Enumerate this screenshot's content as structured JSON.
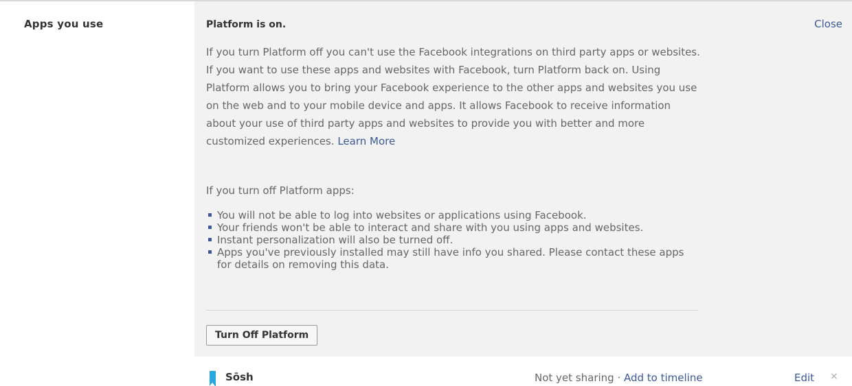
{
  "section": {
    "label": "Apps you use"
  },
  "panel": {
    "title": "Platform is on.",
    "close_label": "Close",
    "description": "If you turn Platform off you can't use the Facebook integrations on third party apps or websites. If you want to use these apps and websites with Facebook, turn Platform back on. Using Platform allows you to bring your Facebook experience to the other apps and websites you use on the web and to your mobile device and apps. It allows Facebook to receive information about your use of third party apps and websites to provide you with better and more customized experiences.",
    "learn_more": "Learn More",
    "subhead": "If you turn off Platform apps:",
    "bullets": [
      "You will not be able to log into websites or applications using Facebook.",
      "Your friends won't be able to interact and share with you using apps and websites.",
      "Instant personalization will also be turned off.",
      "Apps you've previously installed may still have info you shared. Please contact these apps for details on removing this data."
    ],
    "turn_off_button": "Turn Off Platform"
  },
  "app_row": {
    "name": "Sōsh",
    "icon": "bookmark-icon",
    "status": "Not yet sharing · ",
    "add_link": "Add to timeline",
    "edit_label": "Edit",
    "remove_glyph": "×"
  },
  "colors": {
    "link": "#3b5998",
    "panel_bg": "#f2f2f2",
    "app_icon": "#29a8e0"
  }
}
